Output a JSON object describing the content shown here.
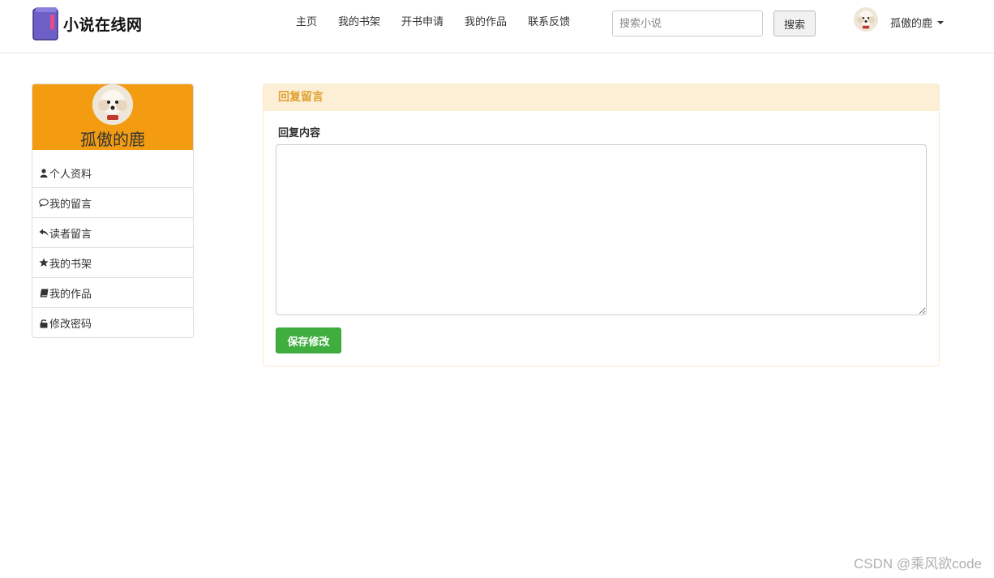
{
  "header": {
    "site_name": "小说在线网",
    "nav": [
      "主页",
      "我的书架",
      "开书申请",
      "我的作品",
      "联系反馈"
    ],
    "search": {
      "placeholder": "搜索小说",
      "button_label": "搜索"
    },
    "user": {
      "name": "孤傲的鹿"
    }
  },
  "sidebar": {
    "profile_name": "孤傲的鹿",
    "items": [
      {
        "label": "个人资料",
        "icon": "user-icon"
      },
      {
        "label": "我的留言",
        "icon": "comment-icon"
      },
      {
        "label": "读者留言",
        "icon": "reply-icon"
      },
      {
        "label": "我的书架",
        "icon": "star-icon"
      },
      {
        "label": "我的作品",
        "icon": "book-icon"
      },
      {
        "label": "修改密码",
        "icon": "lock-icon"
      }
    ]
  },
  "panel": {
    "title": "回复留言",
    "field_label": "回复内容",
    "textarea_value": "",
    "save_label": "保存修改"
  },
  "watermark": "CSDN @乘风欲code",
  "colors": {
    "accent": "#f39c12",
    "panel_heading_bg": "#fdefd6",
    "panel_title": "#e0a030",
    "save_button": "#3fae3f"
  }
}
